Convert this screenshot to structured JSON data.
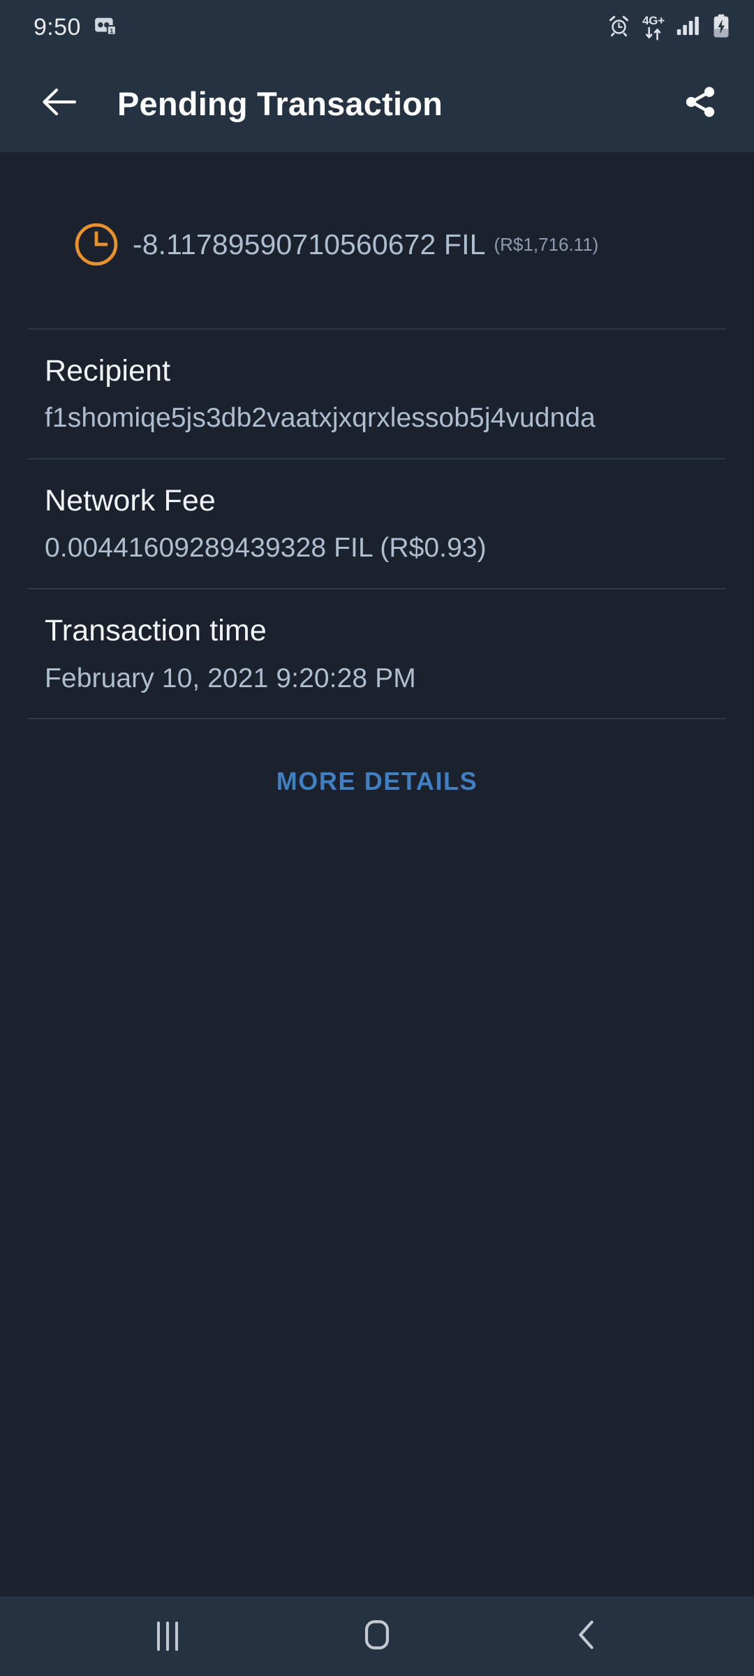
{
  "status_bar": {
    "time": "9:50",
    "left_icons": [
      "voicemail-icon"
    ],
    "network_label": "4G+",
    "right_icons": [
      "alarm-icon",
      "mobile-data-icon",
      "signal-icon",
      "battery-charging-icon"
    ]
  },
  "app_bar": {
    "back_icon": "arrow-left-icon",
    "title": "Pending Transaction",
    "share_icon": "share-icon"
  },
  "transaction": {
    "status_icon": "pending-clock-icon",
    "status_color": "#e8912d",
    "amount": "-8.11789590710560672 FIL",
    "amount_fiat": "(R$1,716.11)",
    "rows": [
      {
        "label": "Recipient",
        "value": "f1shomiqe5js3db2vaatxjxqrxlessob5j4vudnda"
      },
      {
        "label": "Network Fee",
        "value": "0.00441609289439328 FIL (R$0.93)"
      },
      {
        "label": "Transaction time",
        "value": "February 10, 2021 9:20:28 PM"
      }
    ],
    "more_details_label": "MORE DETAILS",
    "more_details_color": "#3f7fc2"
  },
  "nav_bar": {
    "recents_icon": "recents-icon",
    "home_icon": "home-icon",
    "back_icon": "back-chevron-icon"
  },
  "theme": {
    "background": "#1b222e",
    "bar_background": "#253241",
    "primary_text": "#f2f4f7",
    "secondary_text": "#aebdd0",
    "divider": "#2e3847"
  }
}
